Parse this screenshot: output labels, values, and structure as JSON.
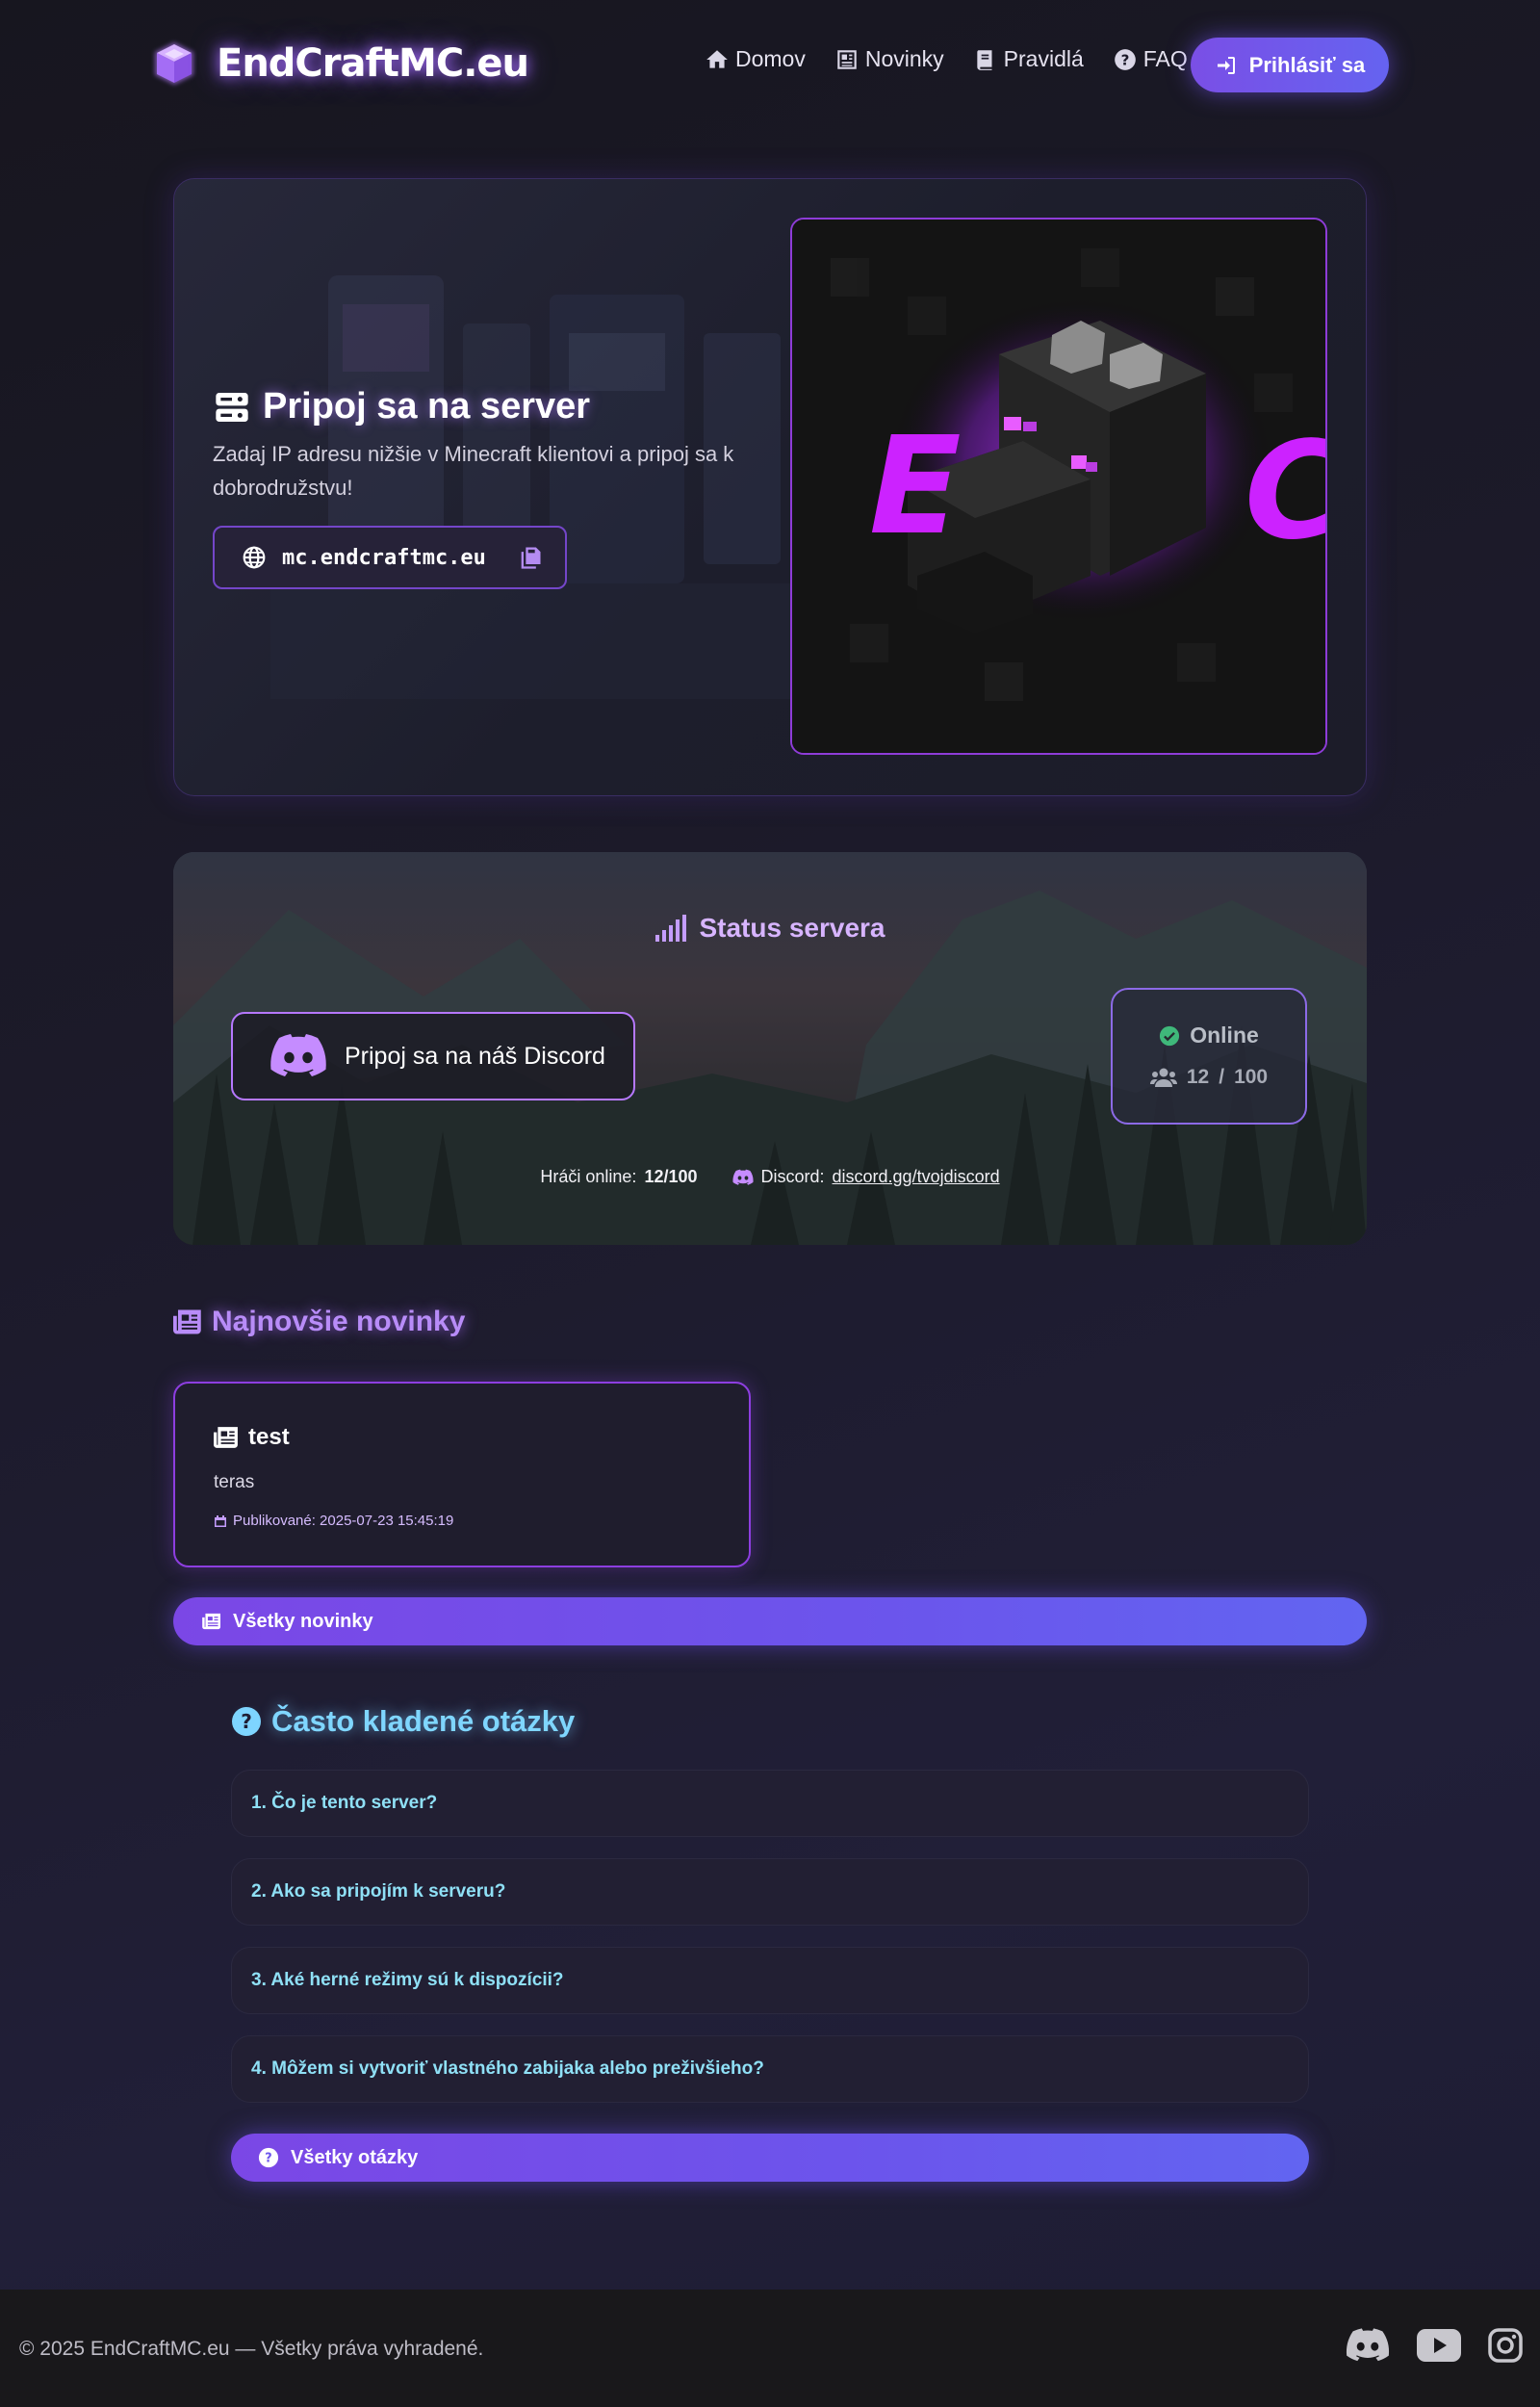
{
  "brand": {
    "name": "EndCraftMC.eu"
  },
  "nav": {
    "items": [
      {
        "label": "Domov",
        "icon": "home-icon"
      },
      {
        "label": "Novinky",
        "icon": "newspaper-icon"
      },
      {
        "label": "Pravidlá",
        "icon": "book-icon"
      },
      {
        "label": "FAQ",
        "icon": "question-circle-icon"
      }
    ],
    "login_label": "Prihlásiť sa"
  },
  "hero": {
    "title": "Pripoj sa na server",
    "description": "Zadaj IP adresu nižšie v Minecraft klientovi a pripoj sa k dobrodružstvu!",
    "ip": "mc.endcraftmc.eu",
    "logo_letters": [
      "E",
      "C"
    ]
  },
  "status": {
    "title": "Status servera",
    "discord_button": "Pripoj sa na náš Discord",
    "online_label": "Online",
    "players_current": "12",
    "players_sep": "/",
    "players_max": "100",
    "footer_players_label": "Hráči online:",
    "footer_players_value": "12/100",
    "footer_discord_label": "Discord:",
    "footer_discord_link": "discord.gg/tvojdiscord"
  },
  "news": {
    "title": "Najnovšie novinky",
    "items": [
      {
        "title": "test",
        "text": "teras",
        "date": "Publikované: 2025-07-23 15:45:19"
      }
    ],
    "all_button": "Všetky novinky"
  },
  "faq": {
    "title": "Často kladené otázky",
    "items": [
      "1. Čo je tento server?",
      "2. Ako sa pripojím k serveru?",
      "3. Aké herné režimy sú k dispozícii?",
      "4. Môžem si vytvoriť vlastného zabijaka alebo preživšieho?"
    ],
    "all_button": "Všetky otázky"
  },
  "footer": {
    "copyright": "© 2025 EndCraftMC.eu — Všetky práva vyhradené.",
    "social": [
      "discord-icon",
      "youtube-icon",
      "instagram-icon"
    ]
  },
  "colors": {
    "accent_purple": "#7b47e6",
    "accent_blue": "#6265f1",
    "faq_cyan": "#8fe0f6",
    "online_green": "#3fb87a"
  }
}
